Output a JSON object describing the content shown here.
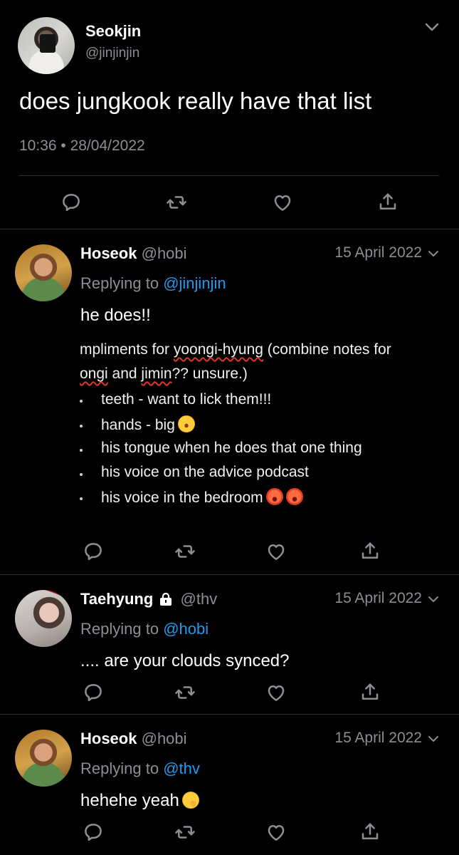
{
  "main_tweet": {
    "name": "Seokjin",
    "handle": "@jinjinjin",
    "text": "does jungkook really have that list",
    "timestamp": "10:36 • 28/04/2022"
  },
  "replies": [
    {
      "name": "Hoseok",
      "handle": "@hobi",
      "date": "15 April 2022",
      "replying_prefix": "Replying to",
      "replying_to": "@jinjinjin",
      "text": "he does!!",
      "attachment": {
        "line1_a": "mpliments for ",
        "line1_b": "yoongi-hyung",
        "line1_c": " (combine notes for",
        "line2_a": "ongi",
        "line2_b": " and ",
        "line2_c": "jimin",
        "line2_d": "?? unsure.)",
        "items": [
          "teeth - want to lick them!!!",
          "hands - big",
          "his tongue when he does that one thing",
          "his voice on the advice podcast",
          "his voice in the bedroom"
        ]
      }
    },
    {
      "name": "Taehyung",
      "handle": "@thv",
      "date": "15 April 2022",
      "replying_prefix": "Replying to",
      "replying_to": "@hobi",
      "text": ".... are your clouds synced?"
    },
    {
      "name": "Hoseok",
      "handle": "@hobi",
      "date": "15 April 2022",
      "replying_prefix": "Replying to",
      "replying_to": "@thv",
      "text": "hehehe yeah"
    }
  ],
  "colors": {
    "background": "#000000",
    "link": "#1d9bf0",
    "muted": "#8b8f94",
    "divider": "#2f3336"
  },
  "icons": [
    "chevron-down-icon",
    "reply-icon",
    "retweet-icon",
    "like-icon",
    "share-icon",
    "lock-icon"
  ]
}
